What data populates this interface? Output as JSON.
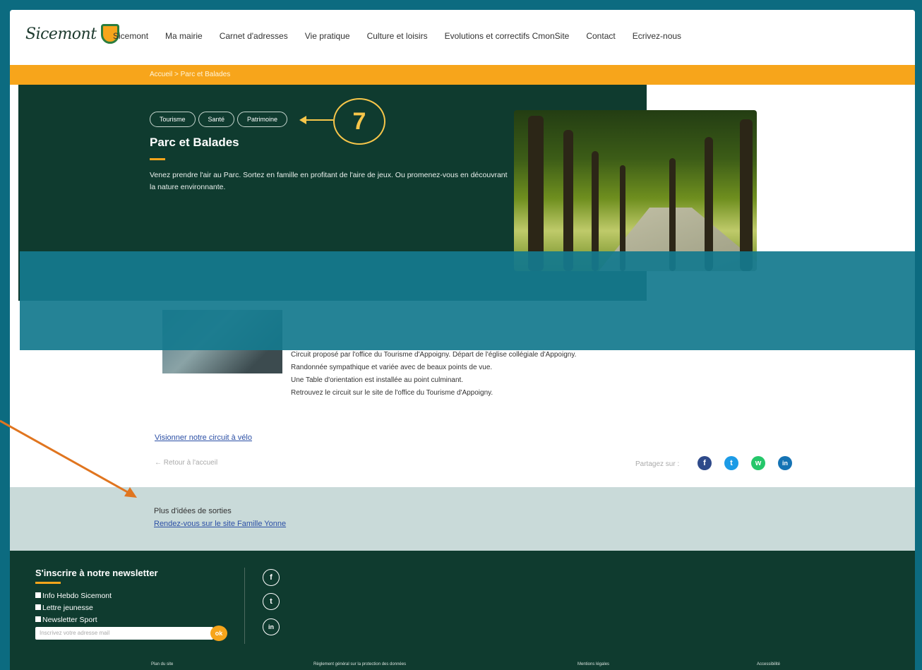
{
  "header": {
    "logo_text": "Sicemont",
    "menu": [
      "Sicemont",
      "Ma mairie",
      "Carnet d'adresses",
      "Vie pratique",
      "Culture et loisirs",
      "Evolutions et correctifs CmonSite",
      "Contact",
      "Ecrivez-nous"
    ]
  },
  "breadcrumb": "Accueil > Parc et Balades",
  "hero": {
    "tags": [
      "Tourisme",
      "Santé",
      "Patrimoine"
    ],
    "annotation_number": "7",
    "title": "Parc et Balades",
    "description": "Venez prendre l'air au Parc. Sortez en famille en profitant de l'aire de jeux. Ou promenez-vous en découvrant la nature environnante."
  },
  "content": {
    "lines": [
      "Circuit proposé par l'office du Tourisme d'Appoigny. Départ de l'église collégiale d'Appoigny.",
      "Randonnée sympathique et variée avec de beaux points de vue.",
      "Une Table d'orientation est installée au point culminant.",
      "Retrouvez le circuit sur le site de l'office du Tourisme d'Appoigny."
    ],
    "video_link": "Visionner notre circuit à vélo",
    "back_link": "← Retour à l'accueil",
    "share_label": "Partagez sur :"
  },
  "share_icons": [
    {
      "name": "facebook-icon",
      "glyph": "f",
      "color": "#2e4a8a"
    },
    {
      "name": "twitter-icon",
      "glyph": "t",
      "color": "#1c9be6"
    },
    {
      "name": "whatsapp-icon",
      "glyph": "w",
      "color": "#25c76a"
    },
    {
      "name": "linkedin-icon",
      "glyph": "in",
      "color": "#1573b4"
    }
  ],
  "ideas": {
    "title": "Plus d'idées de sorties",
    "link": "Rendez-vous sur le site Famille Yonne"
  },
  "footer": {
    "newsletter_title": "S'inscrire à notre newsletter",
    "newsletter_options": [
      "Info Hebdo Sicemont",
      "Lettre jeunesse",
      "Newsletter Sport"
    ],
    "email_placeholder": "Inscrivez votre adresse mail",
    "ok_label": "ok",
    "social": [
      "f",
      "t",
      "in"
    ],
    "bottom_links": [
      "Plan du site",
      "Règlement général sur la protection des données",
      "Mentions légales",
      "Accessibilité"
    ]
  },
  "colors": {
    "accent": "#f7a51b",
    "dark_green": "#0f3b2f",
    "teal": "#0c6b80"
  }
}
